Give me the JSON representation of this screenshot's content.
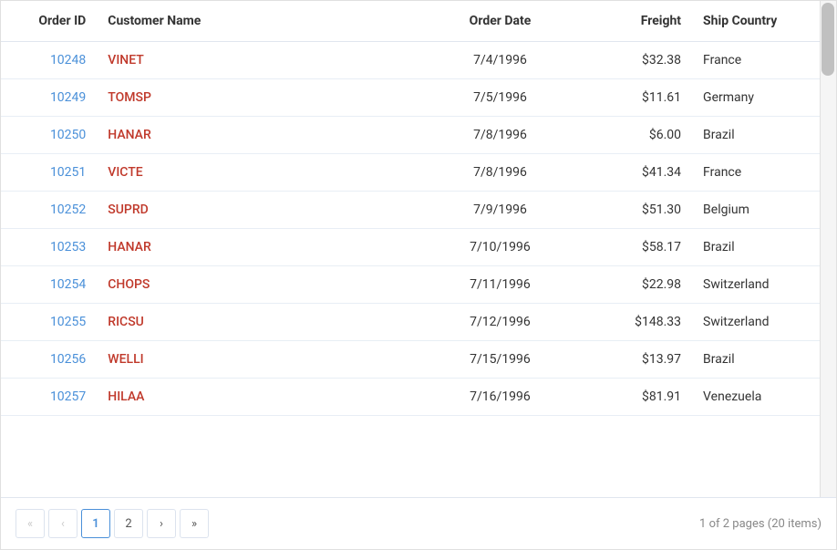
{
  "table": {
    "columns": [
      {
        "key": "order_id",
        "label": "Order ID"
      },
      {
        "key": "customer_name",
        "label": "Customer Name"
      },
      {
        "key": "order_date",
        "label": "Order Date"
      },
      {
        "key": "freight",
        "label": "Freight"
      },
      {
        "key": "ship_country",
        "label": "Ship Country"
      }
    ],
    "rows": [
      {
        "order_id": "10248",
        "customer_name": "VINET",
        "order_date": "7/4/1996",
        "freight": "$32.38",
        "ship_country": "France"
      },
      {
        "order_id": "10249",
        "customer_name": "TOMSP",
        "order_date": "7/5/1996",
        "freight": "$11.61",
        "ship_country": "Germany"
      },
      {
        "order_id": "10250",
        "customer_name": "HANAR",
        "order_date": "7/8/1996",
        "freight": "$6.00",
        "ship_country": "Brazil"
      },
      {
        "order_id": "10251",
        "customer_name": "VICTE",
        "order_date": "7/8/1996",
        "freight": "$41.34",
        "ship_country": "France"
      },
      {
        "order_id": "10252",
        "customer_name": "SUPRD",
        "order_date": "7/9/1996",
        "freight": "$51.30",
        "ship_country": "Belgium"
      },
      {
        "order_id": "10253",
        "customer_name": "HANAR",
        "order_date": "7/10/1996",
        "freight": "$58.17",
        "ship_country": "Brazil"
      },
      {
        "order_id": "10254",
        "customer_name": "CHOPS",
        "order_date": "7/11/1996",
        "freight": "$22.98",
        "ship_country": "Switzerland"
      },
      {
        "order_id": "10255",
        "customer_name": "RICSU",
        "order_date": "7/12/1996",
        "freight": "$148.33",
        "ship_country": "Switzerland"
      },
      {
        "order_id": "10256",
        "customer_name": "WELLI",
        "order_date": "7/15/1996",
        "freight": "$13.97",
        "ship_country": "Brazil"
      },
      {
        "order_id": "10257",
        "customer_name": "HILAA",
        "order_date": "7/16/1996",
        "freight": "$81.91",
        "ship_country": "Venezuela"
      }
    ]
  },
  "pagination": {
    "first_label": "«",
    "prev_label": "‹",
    "next_label": "›",
    "last_label": "»",
    "current_page": "1",
    "page2_label": "2",
    "info": "1 of 2 pages (20 items)"
  }
}
